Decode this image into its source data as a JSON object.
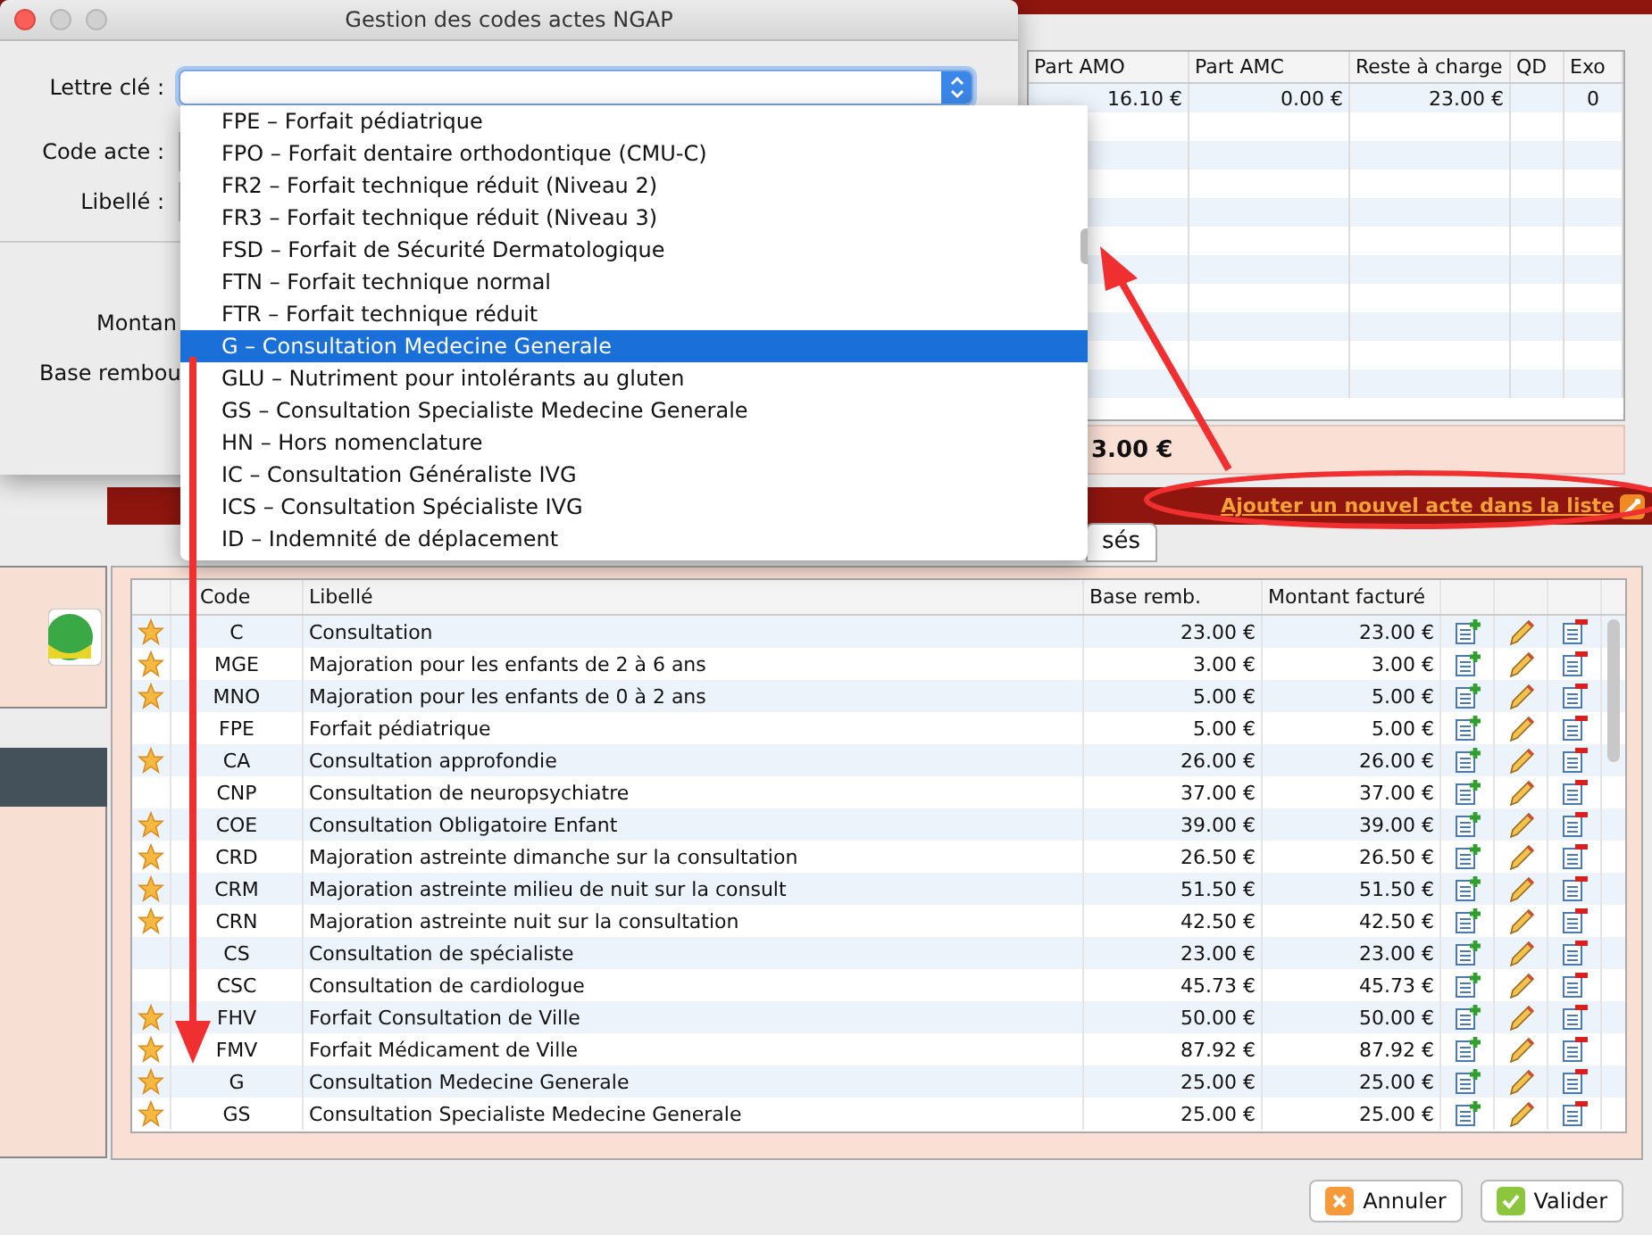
{
  "dialog": {
    "title": "Gestion des codes actes NGAP",
    "fields": [
      {
        "label": "Lettre clé :",
        "kind": "select"
      },
      {
        "label": "Code acte :",
        "kind": "text"
      },
      {
        "label": "Libellé :",
        "kind": "text"
      }
    ],
    "lower_labels": [
      "Montan",
      "Base rembou"
    ],
    "dropdown": [
      {
        "label": "FPE – Forfait pédiatrique",
        "selected": false
      },
      {
        "label": "FPO – Forfait dentaire orthodontique (CMU-C)",
        "selected": false
      },
      {
        "label": "FR2 – Forfait technique réduit (Niveau 2)",
        "selected": false
      },
      {
        "label": "FR3 – Forfait technique réduit (Niveau 3)",
        "selected": false
      },
      {
        "label": "FSD – Forfait de Sécurité Dermatologique",
        "selected": false
      },
      {
        "label": "FTN – Forfait technique normal",
        "selected": false
      },
      {
        "label": "FTR – Forfait technique réduit",
        "selected": false
      },
      {
        "label": "G – Consultation Medecine Generale",
        "selected": true
      },
      {
        "label": "GLU – Nutriment pour intolérants au gluten",
        "selected": false
      },
      {
        "label": "GS – Consultation Specialiste Medecine Generale",
        "selected": false
      },
      {
        "label": "HN – Hors nomenclature",
        "selected": false
      },
      {
        "label": "IC – Consultation Généraliste IVG",
        "selected": false
      },
      {
        "label": "ICS – Consultation Spécialiste IVG",
        "selected": false
      },
      {
        "label": "ID – Indemnité de déplacement",
        "selected": false
      }
    ]
  },
  "upper_table": {
    "columns": [
      "Part AMO",
      "Part AMC",
      "Reste à charge",
      "QD",
      "Exo"
    ],
    "rows": [
      [
        "16.10 €",
        "0.00 €",
        "23.00 €",
        "",
        "0"
      ]
    ]
  },
  "rac": "3.00 €",
  "add_link": "Ajouter un nouvel acte dans la liste",
  "tab": "sés",
  "acts_table": {
    "columns": [
      "Code",
      "Libellé",
      "Base remb.",
      "Montant facturé"
    ],
    "rows": [
      {
        "favorite": true,
        "code": "C",
        "label": "Consultation",
        "base": "23.00 €",
        "amount": "23.00 €"
      },
      {
        "favorite": true,
        "code": "MGE",
        "label": "Majoration pour les enfants de 2 à 6 ans",
        "base": "3.00 €",
        "amount": "3.00 €"
      },
      {
        "favorite": true,
        "code": "MNO",
        "label": "Majoration pour les enfants de 0 à 2 ans",
        "base": "5.00 €",
        "amount": "5.00 €"
      },
      {
        "favorite": false,
        "code": "FPE",
        "label": "Forfait pédiatrique",
        "base": "5.00 €",
        "amount": "5.00 €"
      },
      {
        "favorite": true,
        "code": "CA",
        "label": "Consultation approfondie",
        "base": "26.00 €",
        "amount": "26.00 €"
      },
      {
        "favorite": false,
        "code": "CNP",
        "label": "Consultation de neuropsychiatre",
        "base": "37.00 €",
        "amount": "37.00 €"
      },
      {
        "favorite": true,
        "code": "COE",
        "label": "Consultation Obligatoire Enfant",
        "base": "39.00 €",
        "amount": "39.00 €"
      },
      {
        "favorite": true,
        "code": "CRD",
        "label": "Majoration astreinte dimanche sur la consultation",
        "base": "26.50 €",
        "amount": "26.50 €"
      },
      {
        "favorite": true,
        "code": "CRM",
        "label": "Majoration astreinte milieu de nuit sur la consult",
        "base": "51.50 €",
        "amount": "51.50 €"
      },
      {
        "favorite": true,
        "code": "CRN",
        "label": "Majoration astreinte nuit sur la consultation",
        "base": "42.50 €",
        "amount": "42.50 €"
      },
      {
        "favorite": false,
        "code": "CS",
        "label": "Consultation de spécialiste",
        "base": "23.00 €",
        "amount": "23.00 €"
      },
      {
        "favorite": false,
        "code": "CSC",
        "label": "Consultation de cardiologue",
        "base": "45.73 €",
        "amount": "45.73 €"
      },
      {
        "favorite": true,
        "code": "FHV",
        "label": "Forfait Consultation de Ville",
        "base": "50.00 €",
        "amount": "50.00 €"
      },
      {
        "favorite": true,
        "code": "FMV",
        "label": "Forfait Médicament de Ville",
        "base": "87.92 €",
        "amount": "87.92 €"
      },
      {
        "favorite": true,
        "code": "G",
        "label": "Consultation Medecine Generale",
        "base": "25.00 €",
        "amount": "25.00 €"
      },
      {
        "favorite": true,
        "code": "GS",
        "label": "Consultation Specialiste Medecine Generale",
        "base": "25.00 €",
        "amount": "25.00 €"
      }
    ]
  },
  "buttons": [
    {
      "label": "Annuler",
      "kind": "cancel"
    },
    {
      "label": "Valider",
      "kind": "ok"
    }
  ]
}
